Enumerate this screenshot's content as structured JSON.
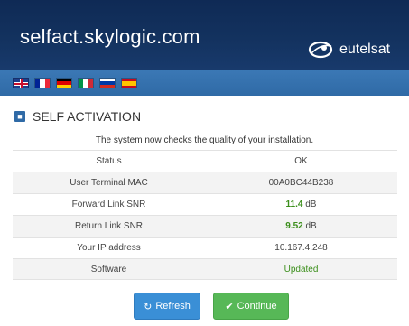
{
  "header": {
    "site_title": "selfact.skylogic.com",
    "brand_name": "eutelsat"
  },
  "languages": [
    {
      "icon": "flag-uk-icon"
    },
    {
      "icon": "flag-fr-icon"
    },
    {
      "icon": "flag-de-icon"
    },
    {
      "icon": "flag-it-icon"
    },
    {
      "icon": "flag-ru-icon"
    },
    {
      "icon": "flag-es-icon"
    }
  ],
  "panel": {
    "title": "SELF ACTIVATION",
    "intro": "The system now checks the quality of your installation."
  },
  "table": {
    "rows": [
      {
        "label": "Status",
        "value": "OK"
      },
      {
        "label": "User Terminal MAC",
        "value": "00A0BC44B238"
      },
      {
        "label": "Forward Link SNR",
        "value_number": "11.4",
        "value_unit": " dB"
      },
      {
        "label": "Return Link SNR",
        "value_number": "9.52",
        "value_unit": " dB"
      },
      {
        "label": "Your IP address",
        "value": "10.167.4.248"
      },
      {
        "label": "Software",
        "value": "Updated"
      }
    ]
  },
  "buttons": {
    "refresh_label": "Refresh",
    "continue_label": "Continue"
  },
  "colors": {
    "header_bg": "#13325f",
    "langbar_bg": "#3374b0",
    "good": "#3c8f1c",
    "refresh_btn": "#3a8fd6",
    "continue_btn": "#57b857"
  }
}
